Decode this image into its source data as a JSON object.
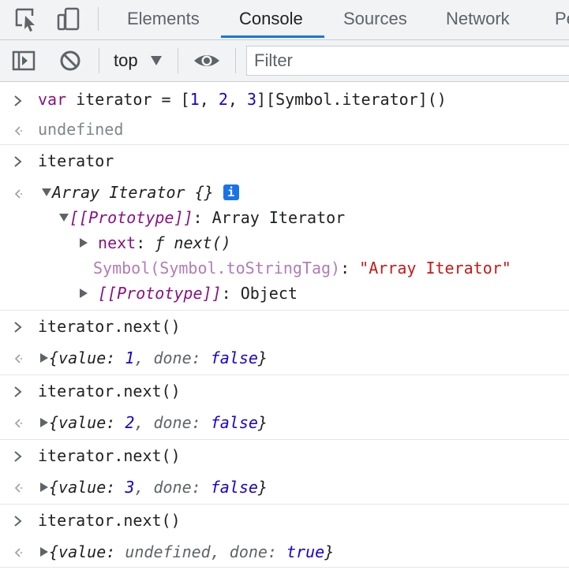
{
  "tabs": [
    {
      "label": "Elements"
    },
    {
      "label": "Console"
    },
    {
      "label": "Sources"
    },
    {
      "label": "Network"
    },
    {
      "label": "Pe"
    }
  ],
  "toolbar": {
    "context": "top",
    "filter_placeholder": "Filter"
  },
  "console": {
    "input1": {
      "kw": "var",
      "name": " iterator = [",
      "n1": "1",
      "c1": ", ",
      "n2": "2",
      "c2": ", ",
      "n3": "3",
      "rest": "][Symbol.iterator]()"
    },
    "result1": "undefined",
    "input2": "iterator",
    "obj_header": "Array Iterator {}",
    "info_badge": "i",
    "proto1_key": "[[Prototype]]",
    "proto1_sep": ": ",
    "proto1_val": "Array Iterator",
    "next_key": "next",
    "next_sep": ": ",
    "next_f": "ƒ",
    "next_val": " next()",
    "tag_key": "Symbol(Symbol.toStringTag)",
    "tag_sep": ": ",
    "tag_val": "\"Array Iterator\"",
    "proto2_key": "[[Prototype]]",
    "proto2_sep": ": ",
    "proto2_val": "Object",
    "calls": [
      {
        "input": "iterator.next()",
        "pre": "{value: ",
        "value": "1",
        "mid": ", done: ",
        "done": "false",
        "post": "}"
      },
      {
        "input": "iterator.next()",
        "pre": "{value: ",
        "value": "2",
        "mid": ", done: ",
        "done": "false",
        "post": "}"
      },
      {
        "input": "iterator.next()",
        "pre": "{value: ",
        "value": "3",
        "mid": ", done: ",
        "done": "false",
        "post": "}"
      },
      {
        "input": "iterator.next()",
        "pre": "{value: ",
        "value": "undefined",
        "mid": ", done: ",
        "done": "true",
        "post": "}"
      }
    ]
  }
}
